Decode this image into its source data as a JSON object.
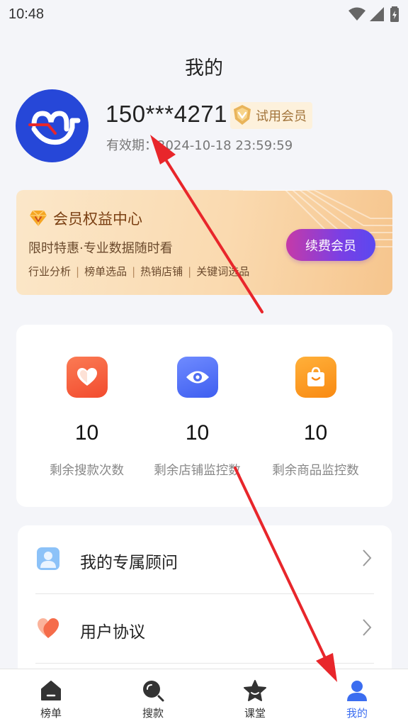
{
  "status_bar": {
    "time": "10:48"
  },
  "page": {
    "title": "我的"
  },
  "profile": {
    "username": "150***4271",
    "badge_label": "试用会员",
    "validity": "有效期：2024-10-18 23:59:59"
  },
  "member_card": {
    "title": "会员权益中心",
    "subtitle": "限时特惠·专业数据随时看",
    "tags": [
      "行业分析",
      "榜单选品",
      "热销店铺",
      "关键词选品"
    ],
    "renew_label": "续费会员"
  },
  "stats": [
    {
      "value": "10",
      "label": "剩余搜款次数",
      "icon": "heart-icon",
      "color": "#f8673f"
    },
    {
      "value": "10",
      "label": "剩余店铺监控数",
      "icon": "eye-icon",
      "color": "#4f6ef2"
    },
    {
      "value": "10",
      "label": "剩余商品监控数",
      "icon": "shopping-bag-icon",
      "color": "#fb9a1b"
    }
  ],
  "menu": [
    {
      "label": "我的专属顾问",
      "icon": "advisor-icon"
    },
    {
      "label": "用户协议",
      "icon": "heart-icon"
    }
  ],
  "tabs": [
    {
      "label": "榜单",
      "icon": "home-icon",
      "active": false
    },
    {
      "label": "搜款",
      "icon": "search-icon",
      "active": false
    },
    {
      "label": "课堂",
      "icon": "classroom-icon",
      "active": false
    },
    {
      "label": "我的",
      "icon": "user-icon",
      "active": true
    }
  ],
  "colors": {
    "accent": "#3b6df0",
    "avatar_bg": "#2647d8",
    "annotation_arrow": "#e8262b"
  }
}
